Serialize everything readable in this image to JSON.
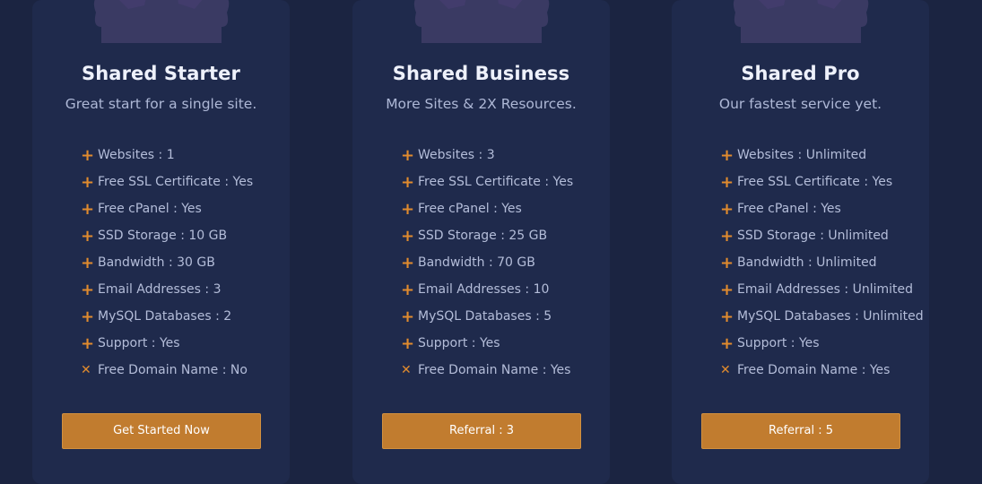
{
  "plans": [
    {
      "title": "Shared Starter",
      "subtitle": "Great start for a single site.",
      "features": [
        {
          "text": "Websites : 1",
          "icon": "plus-icon"
        },
        {
          "text": "Free SSL Certificate : Yes",
          "icon": "plus-icon"
        },
        {
          "text": "Free cPanel : Yes",
          "icon": "plus-icon"
        },
        {
          "text": "SSD Storage : 10 GB",
          "icon": "plus-icon"
        },
        {
          "text": "Bandwidth : 30 GB",
          "icon": "plus-icon"
        },
        {
          "text": "Email Addresses : 3",
          "icon": "plus-icon"
        },
        {
          "text": "MySQL Databases : 2",
          "icon": "plus-icon"
        },
        {
          "text": "Support : Yes",
          "icon": "plus-icon"
        },
        {
          "text": "Free Domain Name : No",
          "icon": "cross-icon"
        }
      ],
      "button": "Get Started Now"
    },
    {
      "title": "Shared Business",
      "subtitle": "More Sites & 2X Resources.",
      "features": [
        {
          "text": "Websites : 3",
          "icon": "plus-icon"
        },
        {
          "text": "Free SSL Certificate : Yes",
          "icon": "plus-icon"
        },
        {
          "text": "Free cPanel : Yes",
          "icon": "plus-icon"
        },
        {
          "text": "SSD Storage : 25 GB",
          "icon": "plus-icon"
        },
        {
          "text": "Bandwidth : 70 GB",
          "icon": "plus-icon"
        },
        {
          "text": "Email Addresses : 10",
          "icon": "plus-icon"
        },
        {
          "text": "MySQL Databases : 5",
          "icon": "plus-icon"
        },
        {
          "text": "Support : Yes",
          "icon": "plus-icon"
        },
        {
          "text": "Free Domain Name : Yes",
          "icon": "cross-icon"
        }
      ],
      "button": "Referral : 3"
    },
    {
      "title": "Shared Pro",
      "subtitle": "Our fastest service yet.",
      "features": [
        {
          "text": "Websites : Unlimited",
          "icon": "plus-icon"
        },
        {
          "text": "Free SSL Certificate : Yes",
          "icon": "plus-icon"
        },
        {
          "text": "Free cPanel : Yes",
          "icon": "plus-icon"
        },
        {
          "text": "SSD Storage : Unlimited",
          "icon": "plus-icon"
        },
        {
          "text": "Bandwidth : Unlimited",
          "icon": "plus-icon"
        },
        {
          "text": "Email Addresses : Unlimited",
          "icon": "plus-icon"
        },
        {
          "text": "MySQL Databases : Unlimited",
          "icon": "plus-icon"
        },
        {
          "text": "Support : Yes",
          "icon": "plus-icon"
        },
        {
          "text": "Free Domain Name : Yes",
          "icon": "cross-icon"
        }
      ],
      "button": "Referral : 5"
    }
  ],
  "colors": {
    "page_background": "#1b2441",
    "card_background": "#1f2a4c",
    "accent": "#c17c2f",
    "feature_mark": "#e08b2e",
    "title_text": "#eef1fb",
    "body_text": "#b4bdd9"
  }
}
